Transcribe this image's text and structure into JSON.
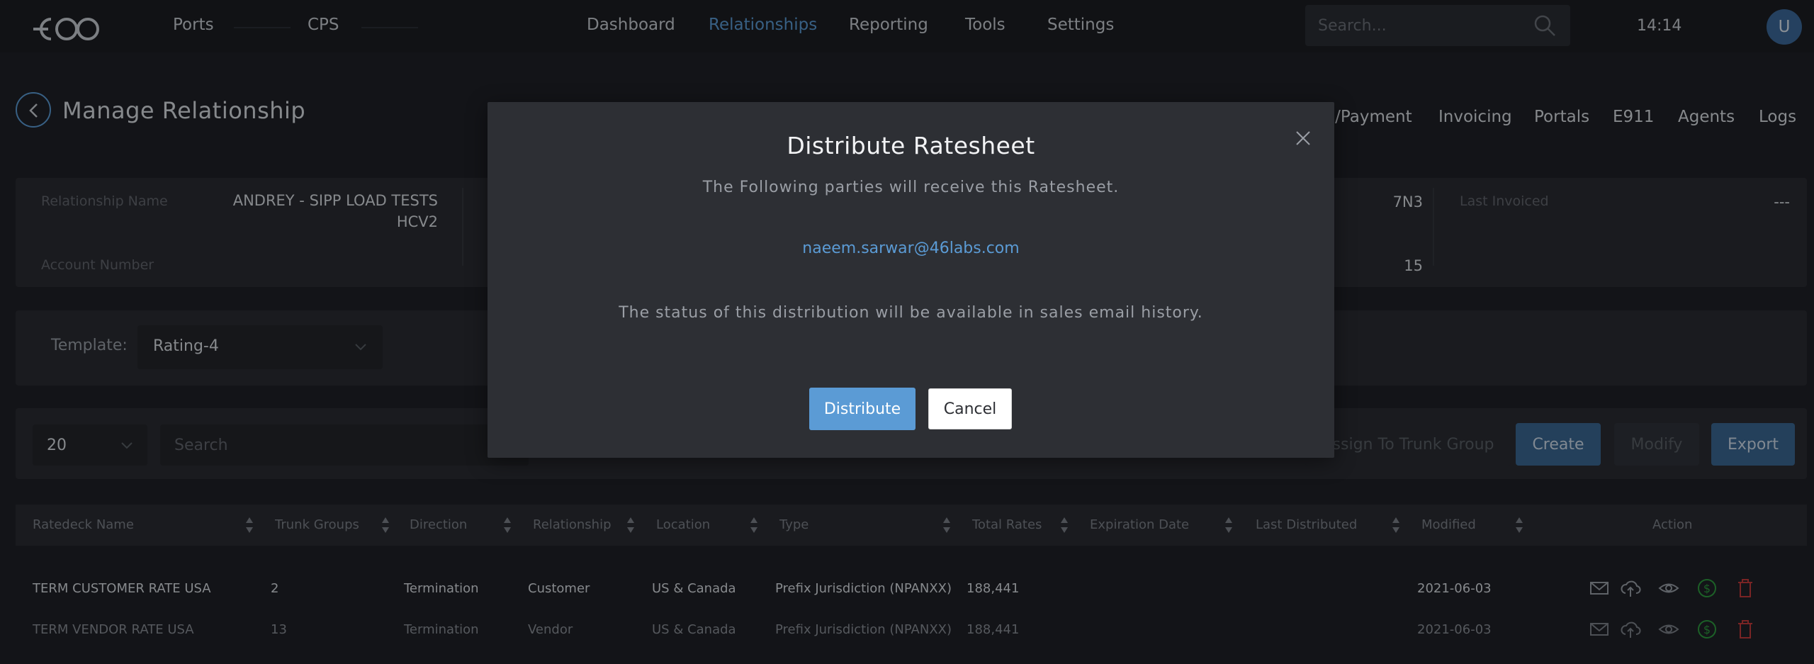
{
  "nav": {
    "links": [
      "Ports",
      "CPS",
      "Dashboard",
      "Relationships",
      "Reporting",
      "Tools",
      "Settings"
    ],
    "active": "Relationships",
    "search_placeholder": "Search...",
    "clock": "14:14",
    "avatar_initial": "U"
  },
  "page": {
    "title": "Manage  Relationship",
    "tabs": [
      "e/Payment",
      "Invoicing",
      "Portals",
      "E911",
      "Agents",
      "Logs"
    ]
  },
  "info": {
    "relationship_name_label": "Relationship Name",
    "relationship_name_value": [
      "ANDREY - SIPP LOAD TESTS",
      "HCV2"
    ],
    "account_number_label": "Account Number",
    "right_value_top": "7N3",
    "right_value_bottom": "15",
    "last_invoiced_label": "Last Invoiced",
    "last_invoiced_value": "---"
  },
  "template": {
    "label": "Template:",
    "value": "Rating-4"
  },
  "toolbar": {
    "page_size": "20",
    "search_placeholder": "Search",
    "assign_label": "Assign To Trunk Group",
    "create_label": "Create",
    "modify_label": "Modify",
    "export_label": "Export"
  },
  "table": {
    "headers": [
      "Ratedeck Name",
      "Trunk Groups",
      "Direction",
      "Relationship",
      "Location",
      "Type",
      "Total Rates",
      "Expiration Date",
      "Last Distributed",
      "Modified",
      "Action"
    ],
    "rows": [
      {
        "name": "TERM CUSTOMER RATE USA",
        "trunk_groups": "2",
        "direction": "Termination",
        "relationship": "Customer",
        "location": "US & Canada",
        "type": "Prefix Jurisdiction (NPANXX)",
        "total_rates": "188,441",
        "expiration": "",
        "last_distributed": "",
        "modified": "2021-06-03"
      },
      {
        "name": "TERM VENDOR RATE USA",
        "trunk_groups": "13",
        "direction": "Termination",
        "relationship": "Vendor",
        "location": "US & Canada",
        "type": "Prefix Jurisdiction (NPANXX)",
        "total_rates": "188,441",
        "expiration": "",
        "last_distributed": "",
        "modified": "2021-06-03"
      }
    ],
    "action_icons": [
      "mail-icon",
      "cloud-upload-icon",
      "eye-icon",
      "dollar-icon",
      "trash-icon"
    ]
  },
  "modal": {
    "title": "Distribute  Ratesheet",
    "subtitle": "The  Following  parties  will  receive  this  Ratesheet.",
    "email": "naeem.sarwar@46labs.com",
    "status_note": "The  status  of  this  distribution  will  be  available  in  sales  email  history.",
    "distribute_label": "Distribute",
    "cancel_label": "Cancel"
  },
  "colors": {
    "accent": "#5b9bd5",
    "background": "#1f2127",
    "panel": "#2a2c32",
    "success": "#2e9c3f",
    "danger": "#c43a3a"
  }
}
